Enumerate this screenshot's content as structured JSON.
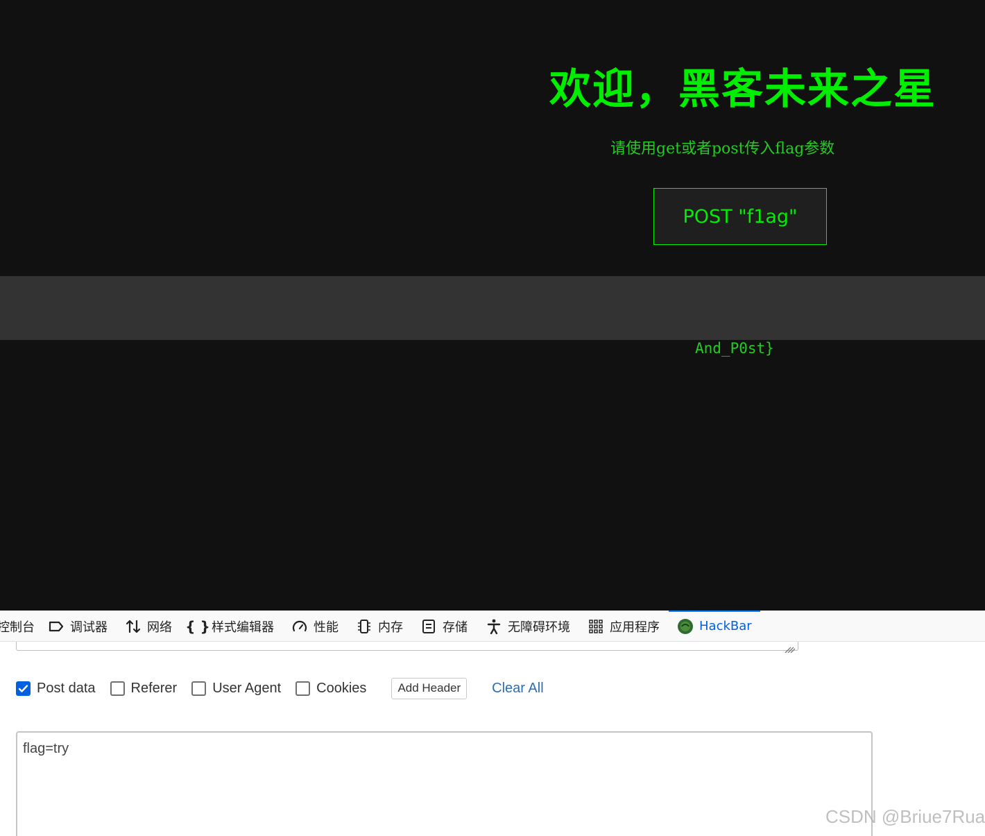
{
  "webpage": {
    "title": "欢迎，黑客未来之星",
    "subtitle": "请使用get或者post传入flag参数",
    "post_button": "POST \"f1ag\"",
    "flag_fragment": "And_P0st}"
  },
  "devtools": {
    "tabs": [
      {
        "label": "控制台",
        "icon": "console-icon"
      },
      {
        "label": "调试器",
        "icon": "debugger-icon"
      },
      {
        "label": "网络",
        "icon": "network-icon"
      },
      {
        "label": "样式编辑器",
        "icon": "style-editor-icon"
      },
      {
        "label": "性能",
        "icon": "performance-icon"
      },
      {
        "label": "内存",
        "icon": "memory-icon"
      },
      {
        "label": "存储",
        "icon": "storage-icon"
      },
      {
        "label": "无障碍环境",
        "icon": "accessibility-icon"
      },
      {
        "label": "应用程序",
        "icon": "application-icon"
      },
      {
        "label": "HackBar",
        "icon": "hackbar-icon",
        "active": true
      }
    ]
  },
  "hackbar": {
    "options": [
      {
        "label": "Post data",
        "checked": true
      },
      {
        "label": "Referer",
        "checked": false
      },
      {
        "label": "User Agent",
        "checked": false
      },
      {
        "label": "Cookies",
        "checked": false
      }
    ],
    "add_header_label": "Add Header",
    "clear_all_label": "Clear All",
    "post_data_value": "flag=try"
  },
  "watermark": "CSDN @Briue7Rua",
  "colors": {
    "page_bg": "#111111",
    "hacker_green": "#00ee00",
    "band_grey": "#333333",
    "active_tab_blue": "#0060df",
    "checkbox_blue": "#0060df",
    "link_blue": "#2a6db8"
  }
}
